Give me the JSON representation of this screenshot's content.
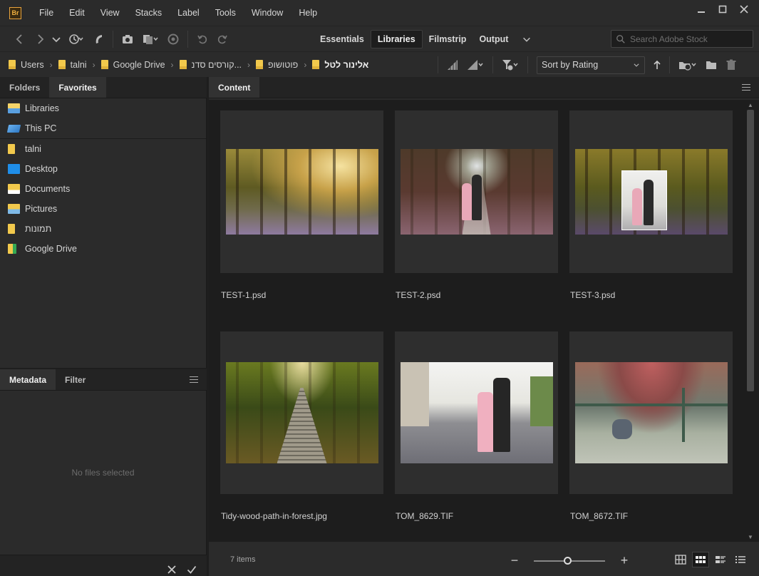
{
  "app": {
    "logo": "Br"
  },
  "menu": [
    "File",
    "Edit",
    "View",
    "Stacks",
    "Label",
    "Tools",
    "Window",
    "Help"
  ],
  "workspaces": {
    "tabs": [
      "Essentials",
      "Libraries",
      "Filmstrip",
      "Output"
    ],
    "active": "Libraries"
  },
  "search": {
    "placeholder": "Search Adobe Stock",
    "value": ""
  },
  "breadcrumb": [
    "Users",
    "talni",
    "Google Drive",
    "קורסים סדנ...",
    "פוטושופ",
    "אלינור לטל"
  ],
  "sort": {
    "label": "Sort by Rating"
  },
  "left_panel": {
    "tabs": [
      "Folders",
      "Favorites"
    ],
    "active": "Favorites",
    "favorites": [
      {
        "label": "Libraries",
        "icon": "libraries-folder-icon"
      },
      {
        "label": "This PC",
        "icon": "computer-icon"
      },
      {
        "label": "talni",
        "icon": "folder-icon"
      },
      {
        "label": "Desktop",
        "icon": "desktop-icon"
      },
      {
        "label": "Documents",
        "icon": "documents-folder-icon"
      },
      {
        "label": "Pictures",
        "icon": "pictures-folder-icon"
      },
      {
        "label": "תמונות",
        "icon": "folder-icon"
      },
      {
        "label": "Google Drive",
        "icon": "google-drive-folder-icon"
      }
    ]
  },
  "metadata_panel": {
    "tabs": [
      "Metadata",
      "Filter"
    ],
    "active": "Metadata",
    "empty_text": "No files selected"
  },
  "content": {
    "tab": "Content",
    "files": [
      {
        "name": "TEST-1.psd"
      },
      {
        "name": "TEST-2.psd"
      },
      {
        "name": "TEST-3.psd"
      },
      {
        "name": "Tidy-wood-path-in-forest.jpg"
      },
      {
        "name": "TOM_8629.TIF"
      },
      {
        "name": "TOM_8672.TIF"
      }
    ],
    "item_count": "7 items"
  },
  "colors": {
    "panel": "#2b2b2b",
    "background": "#1e1e1e",
    "accent_folder": "#f2c94c"
  }
}
